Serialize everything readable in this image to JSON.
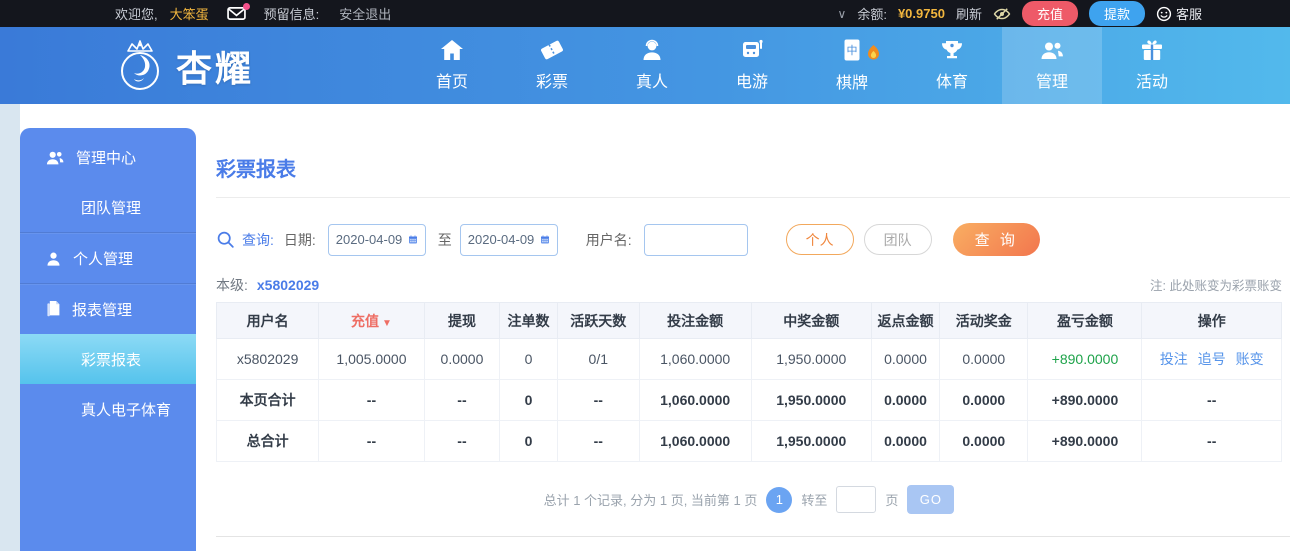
{
  "topbar": {
    "welcome_label": "欢迎您,",
    "username": "大笨蛋",
    "reserved_label": "预留信息:",
    "logout_label": "安全退出",
    "balance_label": "余额:",
    "balance_value": "¥0.9750",
    "refresh_label": "刷新",
    "deposit_label": "充值",
    "withdraw_label": "提款",
    "service_label": "客服"
  },
  "navbar": {
    "logo_text": "杏耀",
    "items": [
      {
        "label": "首页"
      },
      {
        "label": "彩票"
      },
      {
        "label": "真人"
      },
      {
        "label": "电游"
      },
      {
        "label": "棋牌"
      },
      {
        "label": "体育"
      },
      {
        "label": "管理"
      },
      {
        "label": "活动"
      }
    ],
    "active_item": "管理"
  },
  "sidebar": {
    "items": [
      {
        "label": "管理中心"
      },
      {
        "label": "团队管理"
      },
      {
        "label": "个人管理"
      },
      {
        "label": "报表管理"
      },
      {
        "label": "彩票报表"
      },
      {
        "label": "真人电子体育"
      }
    ],
    "active_item": "彩票报表"
  },
  "main": {
    "page_title": "彩票报表",
    "search": {
      "query_label": "查询:",
      "date_label": "日期:",
      "date_from": "2020-04-09",
      "to_label": "至",
      "date_to": "2020-04-09",
      "username_label": "用户名:",
      "username_value": "",
      "personal_button": "个人",
      "team_button": "团队",
      "search_button": "查 询"
    },
    "level_label": "本级:",
    "level_value": "x5802029",
    "note": "注: 此处账变为彩票账变",
    "table": {
      "headers": [
        "用户名",
        "充值",
        "提现",
        "注单数",
        "活跃天数",
        "投注金额",
        "中奖金额",
        "返点金额",
        "活动奖金",
        "盈亏金额",
        "操作"
      ],
      "sort_indicator": "▼",
      "rows": [
        {
          "cells": [
            "x5802029",
            "1,005.0000",
            "0.0000",
            "0",
            "0/1",
            "1,060.0000",
            "1,950.0000",
            "0.0000",
            "0.0000",
            "+890.0000"
          ],
          "ops": [
            "投注",
            "追号",
            "账变"
          ]
        },
        {
          "cells": [
            "本页合计",
            "--",
            "--",
            "0",
            "--",
            "1,060.0000",
            "1,950.0000",
            "0.0000",
            "0.0000",
            "+890.0000"
          ],
          "op_text": "--"
        },
        {
          "cells": [
            "总合计",
            "--",
            "--",
            "0",
            "--",
            "1,060.0000",
            "1,950.0000",
            "0.0000",
            "0.0000",
            "+890.0000"
          ],
          "op_text": "--"
        }
      ]
    },
    "pagination": {
      "summary": "总计 1 个记录, 分为 1 页, 当前第 1 页",
      "current_page": "1",
      "goto_label": "转至",
      "page_unit_label": "页",
      "page_input_value": "",
      "go_button": "GO"
    }
  },
  "colors": {
    "accent_blue": "#4a7ce8",
    "nav_gradient_start": "#3a7ad8",
    "nav_gradient_end": "#52b9ec",
    "sidebar_blue": "#5b8bed",
    "sidebar_active_top": "#8cdaf5",
    "sidebar_active_bottom": "#55c3ec",
    "profit_green": "#1ea34a",
    "sort_red": "#ee6e64",
    "deposit_red": "#ee5a68",
    "withdraw_blue": "#3ea3ef",
    "gold": "#f2b63e"
  }
}
